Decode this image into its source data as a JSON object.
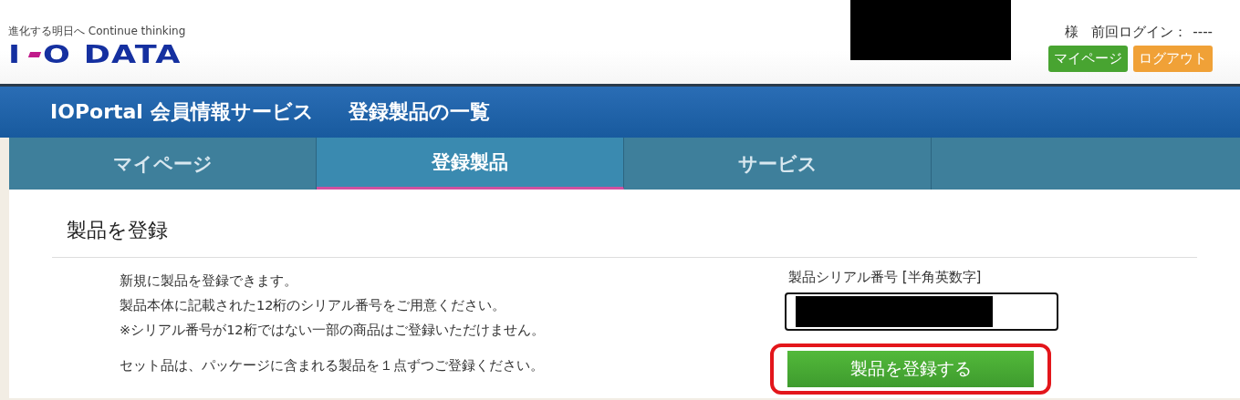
{
  "header": {
    "tagline": "進化する明日へ Continue thinking",
    "logo_left": "I",
    "logo_right": "O DATA",
    "user_suffix": "様",
    "last_login_label": "前回ログイン：",
    "last_login_value": "----",
    "buttons": [
      {
        "label": "マイページ",
        "kind": "mypage"
      },
      {
        "label": "ログアウト",
        "kind": "logout"
      }
    ]
  },
  "title_bar": {
    "service": "IOPortal 会員情報サービス",
    "page": "登録製品の一覧"
  },
  "tabs": [
    {
      "label": "マイページ",
      "selected": false
    },
    {
      "label": "登録製品",
      "selected": true
    },
    {
      "label": "サービス",
      "selected": false
    }
  ],
  "section": {
    "heading": "製品を登録",
    "lines": [
      "新規に製品を登録できます。",
      "製品本体に記載された12桁のシリアル番号をご用意ください。",
      "※シリアル番号が12桁ではない一部の商品はご登録いただけません。"
    ],
    "note": "セット品は、パッケージに含まれる製品を１点ずつご登録ください。",
    "field_label": "製品シリアル番号 [半角英数字]",
    "submit": "製品を登録する",
    "submit_highlighted": true
  }
}
